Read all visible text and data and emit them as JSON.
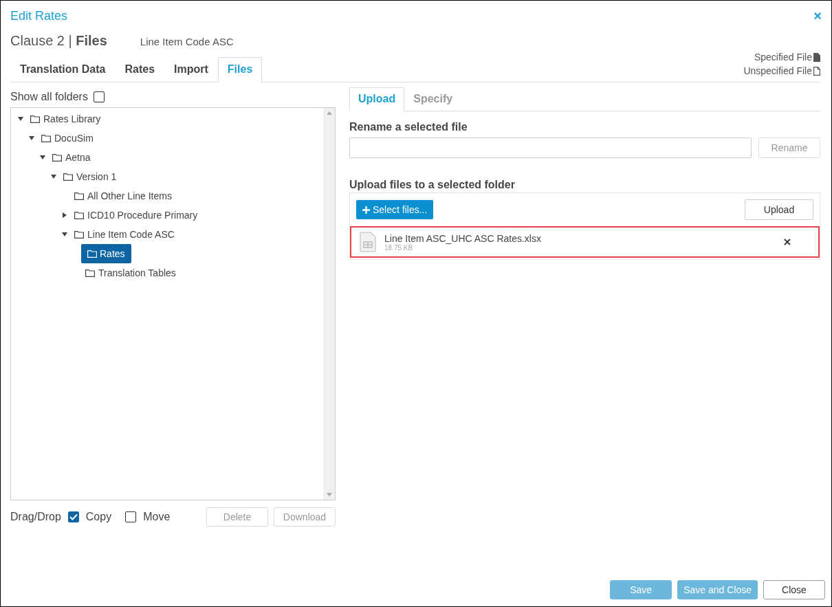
{
  "window": {
    "title": "Edit Rates",
    "close_glyph": "×"
  },
  "header": {
    "heading": "Clause 2 | **Files**",
    "subtitle": "Line Item Code ASC"
  },
  "legend": [
    {
      "label": "Specified File",
      "kind": "filled"
    },
    {
      "label": "Unspecified File",
      "kind": "outline"
    }
  ],
  "tabs": [
    {
      "label": "Translation Data",
      "selected": false
    },
    {
      "label": "Rates",
      "selected": false
    },
    {
      "label": "Import",
      "selected": false
    },
    {
      "label": "Files",
      "selected": true
    }
  ],
  "show_all_folders": {
    "label": "Show all folders",
    "checked": false
  },
  "tree": [
    {
      "label": "Rates Library",
      "expanded": true,
      "selected": false,
      "children": [
        {
          "label": "DocuSim",
          "expanded": true,
          "selected": false,
          "children": [
            {
              "label": "Aetna",
              "expanded": true,
              "selected": false,
              "children": [
                {
                  "label": "Version 1",
                  "expanded": true,
                  "selected": false,
                  "children": [
                    {
                      "label": "All Other Line Items",
                      "selected": false
                    },
                    {
                      "label": "ICD10 Procedure Primary",
                      "expanded": false,
                      "selected": false
                    },
                    {
                      "label": "Line Item Code ASC",
                      "expanded": true,
                      "selected": false,
                      "children": [
                        {
                          "label": "Rates",
                          "selected": true
                        },
                        {
                          "label": "Translation Tables",
                          "selected": false
                        }
                      ]
                    }
                  ]
                }
              ]
            }
          ]
        }
      ]
    }
  ],
  "drag_drop": {
    "label": "Drag/Drop",
    "options": [
      {
        "label": "Copy",
        "checked": true
      },
      {
        "label": "Move",
        "checked": false
      }
    ]
  },
  "tree_buttons": [
    {
      "label": "Delete",
      "disabled": true
    },
    {
      "label": "Download",
      "disabled": true
    }
  ],
  "subtabs": [
    {
      "label": "Upload",
      "selected": true
    },
    {
      "label": "Specify",
      "selected": false
    }
  ],
  "rename": {
    "label": "Rename a selected file",
    "button": {
      "label": "Rename",
      "disabled": true
    }
  },
  "upload": {
    "label": "Upload files to a selected folder",
    "select_button": "Select files...",
    "upload_button": "Upload",
    "files": [
      {
        "name": "Line Item ASC_UHC ASC Rates.xlsx",
        "size": "18.75 KB",
        "highlighted": true
      }
    ]
  },
  "footer_buttons": [
    {
      "label": "Save",
      "kind": "primary",
      "disabled": true
    },
    {
      "label": "Save and Close",
      "kind": "primary",
      "disabled": true
    },
    {
      "label": "Close",
      "kind": "default",
      "disabled": false
    }
  ]
}
